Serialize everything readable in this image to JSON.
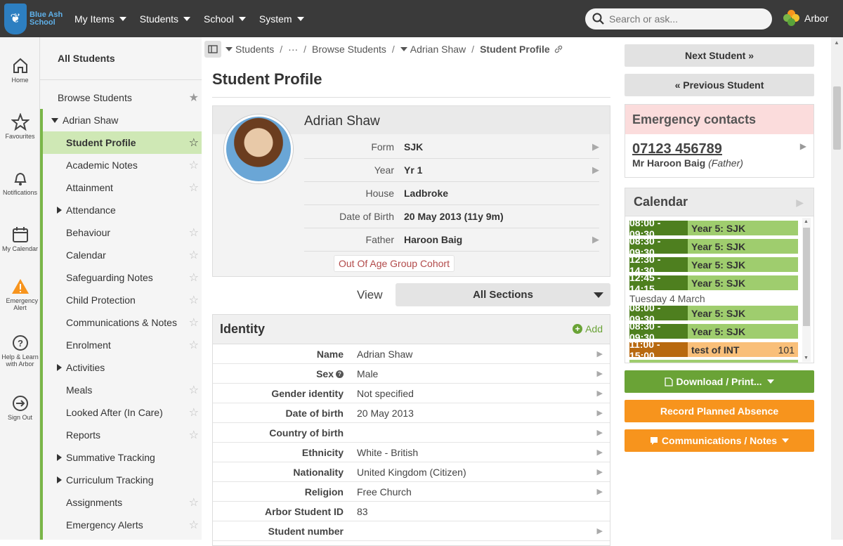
{
  "school": {
    "name_line1": "Blue Ash",
    "name_line2": "School"
  },
  "topnav": [
    "My Items",
    "Students",
    "School",
    "System"
  ],
  "search": {
    "placeholder": "Search or ask..."
  },
  "brand": "Arbor",
  "rail": [
    {
      "label": "Home",
      "icon": "home-icon"
    },
    {
      "label": "Favourites",
      "icon": "star-icon"
    },
    {
      "label": "Notifications",
      "icon": "bell-icon"
    },
    {
      "label": "My Calendar",
      "icon": "calendar-icon"
    },
    {
      "label": "Emergency Alert",
      "icon": "warning-icon"
    },
    {
      "label": "Help & Learn with Arbor",
      "icon": "help-icon"
    },
    {
      "label": "Sign Out",
      "icon": "sign-out-icon"
    }
  ],
  "sidebar": {
    "title": "All Students",
    "browse": "Browse Students",
    "student": "Adrian Shaw",
    "items": [
      {
        "label": "Student Profile",
        "expand": false,
        "star": true
      },
      {
        "label": "Academic Notes",
        "expand": false,
        "star": true
      },
      {
        "label": "Attainment",
        "expand": false,
        "star": true
      },
      {
        "label": "Attendance",
        "expand": true,
        "star": false
      },
      {
        "label": "Behaviour",
        "expand": false,
        "star": true
      },
      {
        "label": "Calendar",
        "expand": false,
        "star": true
      },
      {
        "label": "Safeguarding Notes",
        "expand": false,
        "star": true
      },
      {
        "label": "Child Protection",
        "expand": false,
        "star": true
      },
      {
        "label": "Communications & Notes",
        "expand": false,
        "star": true
      },
      {
        "label": "Enrolment",
        "expand": false,
        "star": true
      },
      {
        "label": "Activities",
        "expand": true,
        "star": false
      },
      {
        "label": "Meals",
        "expand": false,
        "star": true
      },
      {
        "label": "Looked After (In Care)",
        "expand": false,
        "star": true
      },
      {
        "label": "Reports",
        "expand": false,
        "star": true
      },
      {
        "label": "Summative Tracking",
        "expand": true,
        "star": false
      },
      {
        "label": "Curriculum Tracking",
        "expand": true,
        "star": false
      },
      {
        "label": "Assignments",
        "expand": false,
        "star": true
      },
      {
        "label": "Emergency Alerts",
        "expand": false,
        "star": true
      }
    ]
  },
  "breadcrumb": {
    "students": "Students",
    "ellipsis": "···",
    "browse": "Browse Students",
    "student": "Adrian Shaw",
    "current": "Student Profile"
  },
  "page_title": "Student Profile",
  "profile": {
    "name": "Adrian Shaw",
    "rows": [
      {
        "label": "Form",
        "value": "SJK",
        "arrow": true
      },
      {
        "label": "Year",
        "value": "Yr 1",
        "arrow": true
      },
      {
        "label": "House",
        "value": "Ladbroke",
        "arrow": false
      },
      {
        "label": "Date of Birth",
        "value": "20 May 2013 (11y 9m)",
        "arrow": false
      },
      {
        "label": "Father",
        "value": "Haroon Baig",
        "arrow": true
      }
    ],
    "cohort": "Out Of Age Group Cohort"
  },
  "view": {
    "label": "View",
    "selected": "All Sections"
  },
  "identity": {
    "title": "Identity",
    "add": "Add",
    "rows": [
      {
        "label": "Name",
        "value": "Adrian Shaw",
        "help": false,
        "arrow": true
      },
      {
        "label": "Sex",
        "value": "Male",
        "help": true,
        "arrow": true
      },
      {
        "label": "Gender identity",
        "value": "Not specified",
        "help": false,
        "arrow": true
      },
      {
        "label": "Date of birth",
        "value": "20 May 2013",
        "help": false,
        "arrow": true
      },
      {
        "label": "Country of birth",
        "value": "",
        "help": false,
        "arrow": true
      },
      {
        "label": "Ethnicity",
        "value": "White - British",
        "help": false,
        "arrow": true
      },
      {
        "label": "Nationality",
        "value": "United Kingdom (Citizen)",
        "help": false,
        "arrow": true
      },
      {
        "label": "Religion",
        "value": "Free Church",
        "help": false,
        "arrow": true
      },
      {
        "label": "Arbor Student ID",
        "value": "83",
        "help": false,
        "arrow": false
      },
      {
        "label": "Student number",
        "value": "",
        "help": false,
        "arrow": true
      }
    ]
  },
  "right": {
    "next": "Next Student »",
    "prev": "« Previous Student",
    "emergency": {
      "title": "Emergency contacts",
      "phone": "07123 456789",
      "name": "Mr Haroon Baig",
      "relation": "(Father)"
    },
    "calendar": {
      "title": "Calendar",
      "date_label": "Tuesday 4 March",
      "events": [
        {
          "time": "08:00 - 09:30",
          "desc": "Year 5: SJK",
          "num": "",
          "kind": "green"
        },
        {
          "time": "08:30 - 09:30",
          "desc": "Year 5: SJK",
          "num": "",
          "kind": "green"
        },
        {
          "time": "12:30 - 14:30",
          "desc": "Year 5: SJK",
          "num": "",
          "kind": "green"
        },
        {
          "time": "12:45 - 14:15",
          "desc": "Year 5: SJK",
          "num": "",
          "kind": "green"
        },
        {
          "time": "08:00 - 09:30",
          "desc": "Year 5: SJK",
          "num": "",
          "kind": "green"
        },
        {
          "time": "08:30 - 09:30",
          "desc": "Year 5: SJK",
          "num": "",
          "kind": "green"
        },
        {
          "time": "11:00 - 15:00",
          "desc": "test of INT",
          "num": "101",
          "kind": "orange"
        }
      ]
    },
    "download": "Download / Print...",
    "absence": "Record Planned Absence",
    "comms": "Communications / Notes"
  },
  "colors": {
    "green": "#6aa336",
    "orange": "#f7941d",
    "event_green_time": "#4e7f1f",
    "event_green_bg": "#9fcd6e",
    "event_orange_time": "#b8690f",
    "event_orange_bg": "#f9bf79"
  }
}
